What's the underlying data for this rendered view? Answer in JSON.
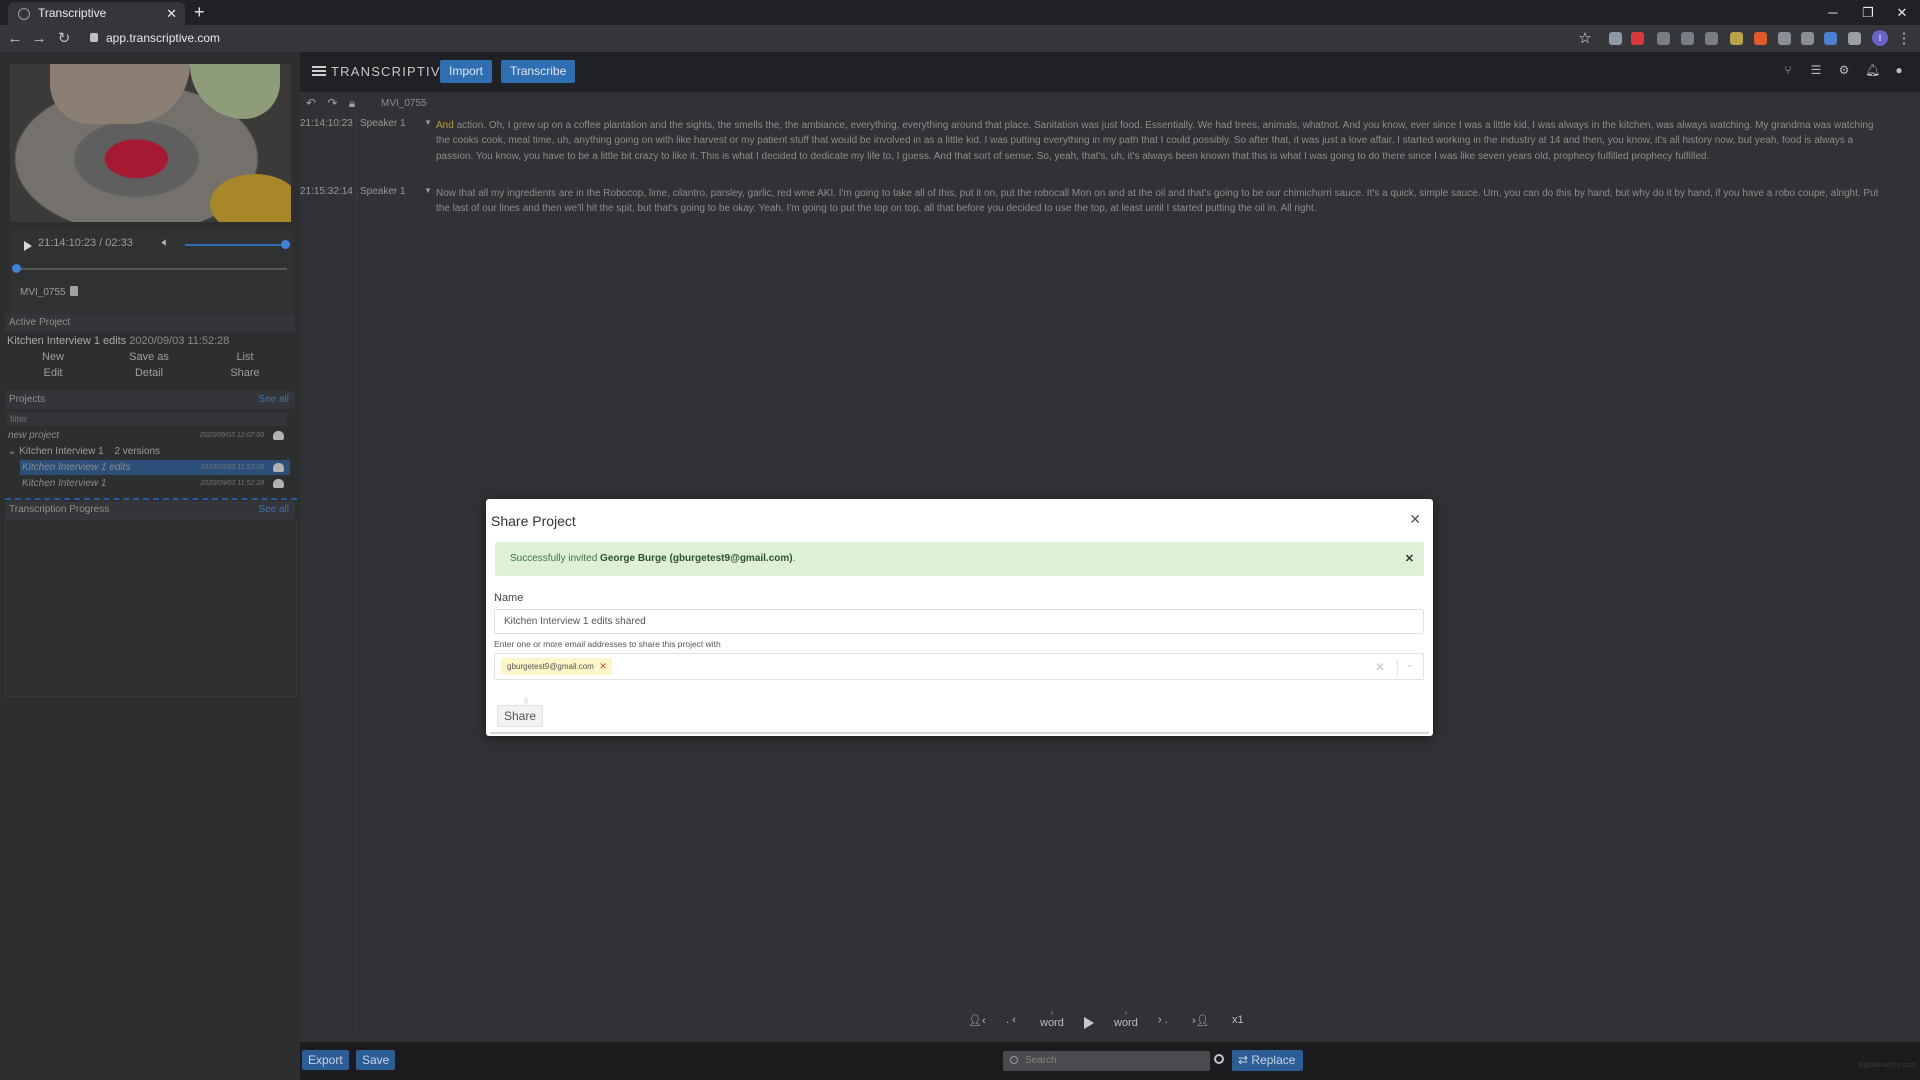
{
  "browser": {
    "tab_title": "Transcriptive",
    "url": "app.transcriptive.com",
    "profile_initial": "I"
  },
  "app": {
    "brand": "TRANSCRIPTIVE",
    "import_label": "Import",
    "transcribe_label": "Transcribe",
    "file_name": "MVI_0755"
  },
  "player": {
    "timecode": "21:14:10:23 / 02:33",
    "clip_name": "MVI_0755"
  },
  "active_project": {
    "heading": "Active Project",
    "name": "Kitchen Interview 1 edits",
    "date": "2020/09/03 11:52:28",
    "actions": [
      "New",
      "Save as",
      "List",
      "Edit",
      "Detail",
      "Share"
    ]
  },
  "projects": {
    "heading": "Projects",
    "see_all": "See all",
    "filter_placeholder": "filter",
    "rows": [
      {
        "name": "new project",
        "date": "2020/09/03 12:07:00"
      },
      {
        "name": "Kitchen Interview 1",
        "versions": "2 versions"
      },
      {
        "name": "Kitchen Interview 1 edits",
        "date": "2020/09/03 11:52:28"
      },
      {
        "name": "Kitchen Interview 1",
        "date": "2020/09/03 11:52:28"
      }
    ]
  },
  "transcription_progress": {
    "heading": "Transcription Progress",
    "see_all": "See all"
  },
  "transcript": [
    {
      "timecode": "21:14:10:23",
      "speaker": "Speaker 1",
      "first_word": "And",
      "text": "action. Oh, I grew up on a coffee plantation and the sights, the smells the, the ambiance, everything, everything around that place. Sanitation was just food. Essentially. We had trees, animals, whatnot. And you know, ever since I was a little kid, I was always in the kitchen, was always watching. My grandma was watching the cooks cook, meal time, uh, anything going on with like harvest or my patient stuff that would be involved in as a little kid. I was putting everything in my path that I could possibly. So after that, it was just a love affair. I started working in the industry at 14 and then, you know, it's all history now, but yeah, food is always a passion. You know, you have to be a little bit crazy to like it. This is what I decided to dedicate my life to, I guess. And that sort of sense. So, yeah, that's, uh, it's always been known that this is what I was going to do there since I was like seven years old, prophecy fulfilled prophecy fulfilled."
    },
    {
      "timecode": "21:15:32:14",
      "speaker": "Speaker 1",
      "first_word": "",
      "text": "Now that all my ingredients are in the Robocop, lime, cilantro, parsley, garlic, red wine AKI. I'm going to take all of this, put it on, put the robocall Mon on and at the oil and that's going to be our chimichurri sauce. It's a quick, simple sauce. Um, you can do this by hand, but why do it by hand, if you have a robo coupe, alright. Put the last of our lines and then we'll hit the spit, but that's going to be okay. Yeah. I'm going to put the top on top, all that before you decided to use the top, at least until I started putting the oil in. All right."
    }
  ],
  "playback": {
    "word_label": "word",
    "speed": "x1"
  },
  "bottom": {
    "export_label": "Export",
    "save_label": "Save",
    "search_placeholder": "Search",
    "replace_label": "Replace",
    "watermark": "digitalanarchy.com"
  },
  "modal": {
    "title": "Share Project",
    "alert_prefix": "Successfully invited",
    "alert_name": "George Burge (gburgetest9@gmail.com)",
    "alert_suffix": ".",
    "name_label": "Name",
    "name_value": "Kitchen Interview 1 edits shared",
    "emails_label": "Enter one or more email addresses to share this project with",
    "email_chip": "gburgetest9@gmail.com",
    "share_label": "Share"
  },
  "colors": {
    "accent": "#2f6eb1",
    "success_bg": "#dff0d8",
    "success_text": "#3c763d"
  }
}
